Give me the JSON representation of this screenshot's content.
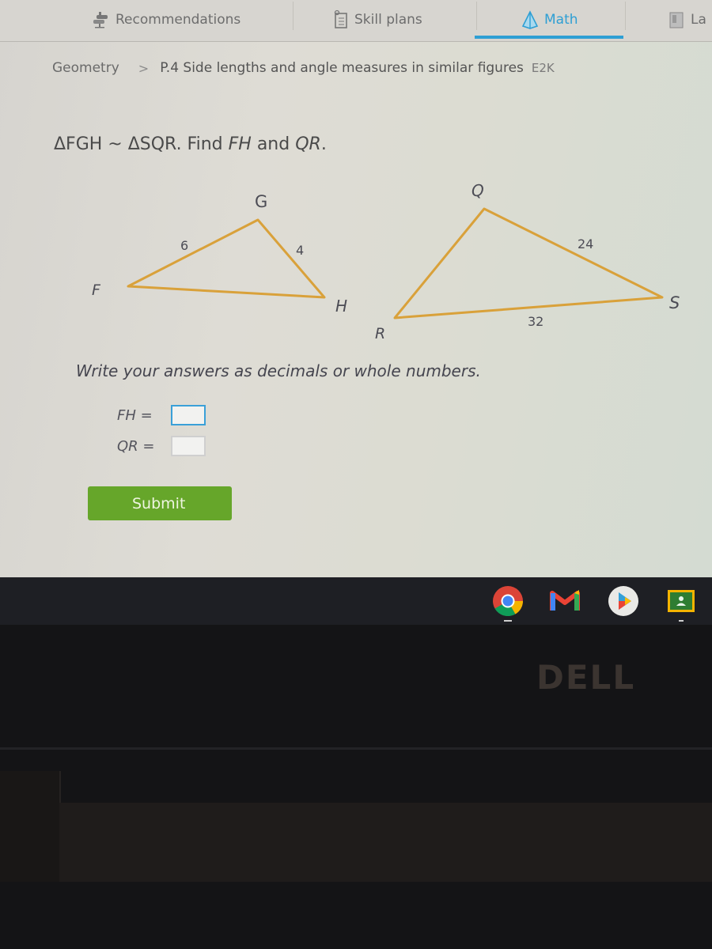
{
  "nav": {
    "tabs": [
      {
        "label": "Recommendations",
        "icon": "recommendations-icon",
        "active": false
      },
      {
        "label": "Skill plans",
        "icon": "skill-plans-icon",
        "active": false
      },
      {
        "label": "Math",
        "icon": "pyramid-icon",
        "active": true
      },
      {
        "label": "La",
        "icon": "language-arts-icon",
        "active": false
      }
    ],
    "accent_color": "#2e9fd4"
  },
  "breadcrumb": {
    "subject": "Geometry",
    "separator": ">",
    "skill": "P.4 Side lengths and angle measures in similar figures",
    "code": "E2K"
  },
  "question": {
    "tri1": "ΔFGH",
    "sim": " ~ ",
    "tri2": "ΔSQR",
    "find": ". Find ",
    "var1": "FH",
    "and": " and ",
    "var2": "QR",
    "end": "."
  },
  "figure": {
    "triangle1": {
      "vertices": [
        "F",
        "G",
        "H"
      ],
      "side_labels": {
        "FG": "6",
        "GH": "4"
      }
    },
    "triangle2": {
      "vertices": [
        "S",
        "Q",
        "R"
      ],
      "side_labels": {
        "QS": "24",
        "RS": "32"
      }
    },
    "stroke_color": "#d9a13a"
  },
  "instructions": "Write your answers as decimals or whole numbers.",
  "answers": [
    {
      "label": "FH",
      "equals": "=",
      "value": ""
    },
    {
      "label": "QR",
      "equals": "=",
      "value": ""
    }
  ],
  "submit_label": "Submit",
  "submit_color": "#66a62a",
  "shelf": {
    "apps": [
      "chrome-icon",
      "gmail-icon",
      "play-store-icon",
      "classroom-icon"
    ]
  },
  "brand": "DELL"
}
